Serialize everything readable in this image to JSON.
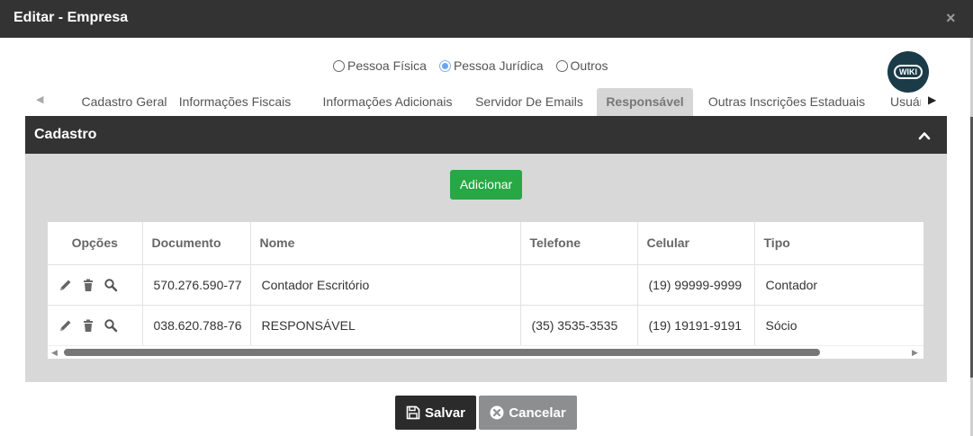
{
  "window": {
    "title": "Editar - Empresa",
    "close": "×"
  },
  "person_type": {
    "options": [
      "Pessoa Física",
      "Pessoa Jurídica",
      "Outros"
    ],
    "selected": "Pessoa Jurídica"
  },
  "wiki": {
    "label": "WIKI"
  },
  "tabs": {
    "items": [
      "Cadastro Geral",
      "Informações Fiscais",
      "Informações Adicionais",
      "Servidor De Emails",
      "Responsável",
      "Outras Inscrições Estaduais",
      "Usuários"
    ],
    "active": "Responsável"
  },
  "panel": {
    "title": "Cadastro",
    "add_label": "Adicionar"
  },
  "table": {
    "columns": [
      "Opções",
      "Documento",
      "Nome",
      "Telefone",
      "Celular",
      "Tipo"
    ],
    "rows": [
      {
        "documento": "570.276.590-77",
        "nome": "Contador Escritório",
        "telefone": "",
        "celular": "(19) 99999-9999",
        "tipo": "Contador"
      },
      {
        "documento": "038.620.788-76",
        "nome": "RESPONSÁVEL",
        "telefone": "(35) 3535-3535",
        "celular": "(19) 19191-9191",
        "tipo": "Sócio"
      }
    ]
  },
  "footer": {
    "save_label": "Salvar",
    "cancel_label": "Cancelar"
  },
  "colors": {
    "header_dark": "#333333",
    "add_green": "#28a745",
    "radio_blue": "#6aa6ea",
    "cancel_gray": "#8c8e90"
  }
}
